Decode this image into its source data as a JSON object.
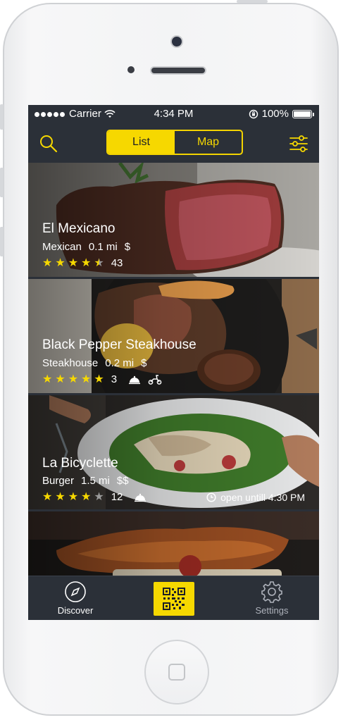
{
  "status_bar": {
    "carrier": "Carrier",
    "time": "4:34 PM",
    "battery": "100%"
  },
  "nav": {
    "segments": [
      "List",
      "Map"
    ],
    "active_segment": "List"
  },
  "restaurants": [
    {
      "name": "El Mexicano",
      "cuisine": "Mexican",
      "distance": "0.1 mi",
      "price": "$",
      "rating": 4.5,
      "reviews": "43"
    },
    {
      "name": "Black Pepper Steakhouse",
      "cuisine": "Steakhouse",
      "distance": "0.2 mi",
      "price": "$",
      "rating": 5,
      "reviews": "3",
      "amenities": [
        "room-service-icon",
        "scooter-icon"
      ]
    },
    {
      "name": "La Bicyclette",
      "cuisine": "Burger",
      "distance": "1.5 mi",
      "price": "$$",
      "rating": 4,
      "reviews": "12",
      "amenities": [
        "room-service-icon"
      ],
      "open_status": "open untill 4:30 PM"
    }
  ],
  "tabbar": {
    "discover": "Discover",
    "settings": "Settings"
  },
  "colors": {
    "accent": "#f6d800",
    "background": "#2b3038"
  }
}
